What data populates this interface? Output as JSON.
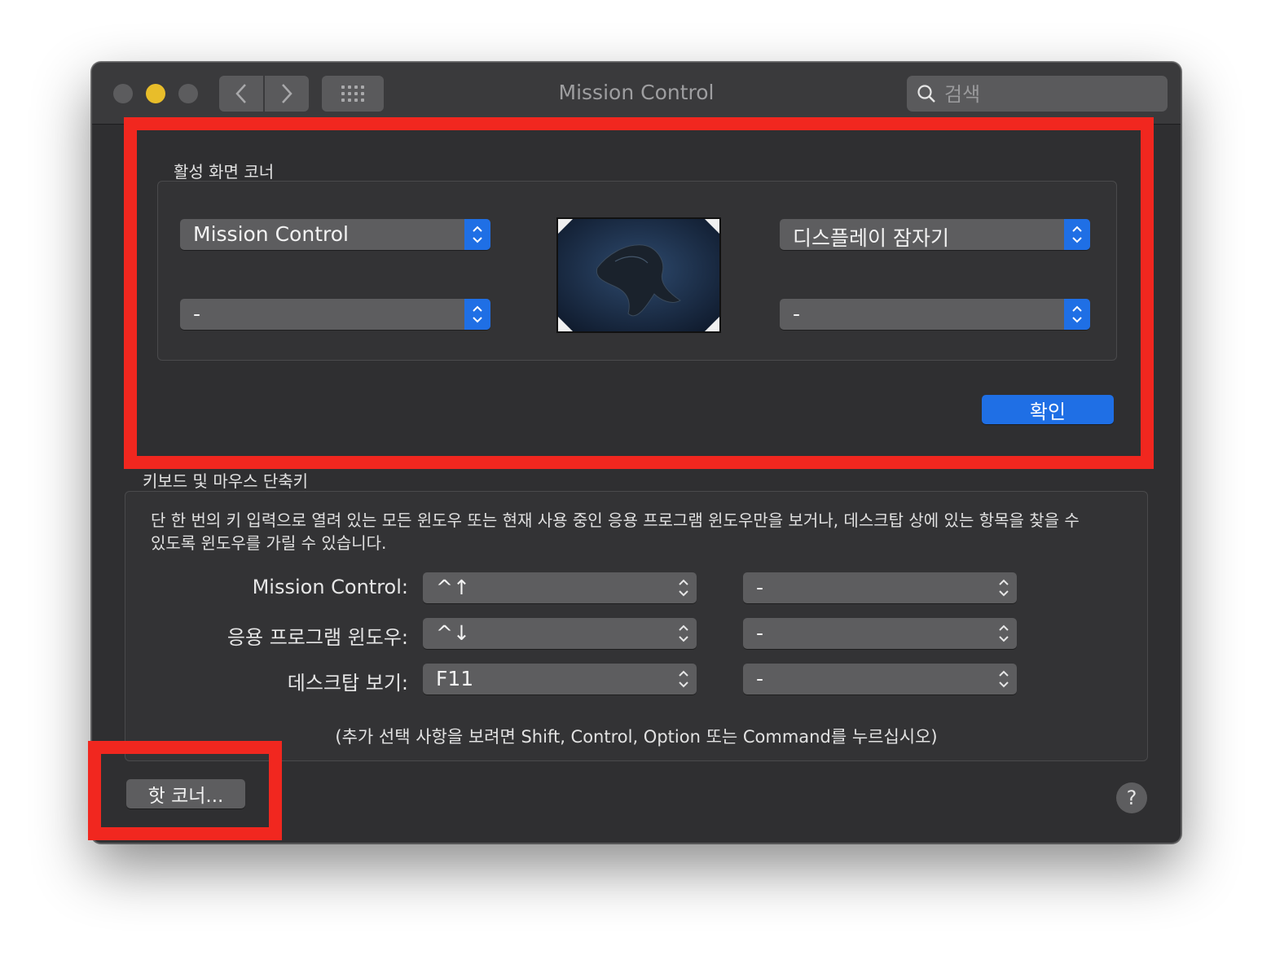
{
  "window": {
    "title": "Mission Control"
  },
  "search": {
    "placeholder": "검색"
  },
  "hot_corners_section": {
    "label": "활성 화면 코너",
    "top_left": "Mission Control",
    "bottom_left": "-",
    "top_right": "디스플레이 잠자기",
    "bottom_right": "-",
    "ok_label": "확인"
  },
  "shortcuts_section": {
    "label": "키보드 및 마우스 단축키",
    "description_line1": "단 한 번의 키 입력으로 열려 있는 모든 윈도우 또는 현재 사용 중인 응용 프로그램 윈도우만을 보거나, 데스크탑 상에 있는 항목을 찾을 수",
    "description_line2": "있도록 윈도우를 가릴 수 있습니다.",
    "rows": [
      {
        "label": "Mission Control:",
        "keyboard": "^↑",
        "mouse": "-"
      },
      {
        "label": "응용 프로그램 윈도우:",
        "keyboard": "^↓",
        "mouse": "-"
      },
      {
        "label": "데스크탑 보기:",
        "keyboard": "F11",
        "mouse": "-"
      }
    ],
    "hint": "(추가 선택 사항을 보려면 Shift, Control, Option 또는 Command를 누르십시오)"
  },
  "footer": {
    "hot_corners_button": "핫 코너...",
    "help_button": "?"
  },
  "colors": {
    "accent": "#1f6fe5",
    "highlight": "#f1271f",
    "traffic_yellow": "#e8bd2a"
  },
  "icons": [
    "back-chevron-icon",
    "forward-chevron-icon",
    "grid-icon",
    "search-icon",
    "stepper-icon"
  ]
}
